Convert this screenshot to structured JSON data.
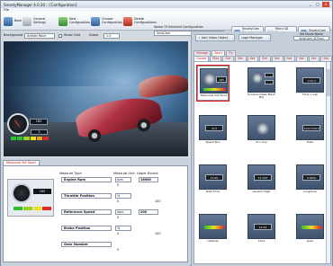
{
  "app": {
    "title": "SmartyManager 4.0.30 :: [Configuration]"
  },
  "menu": {
    "items": [
      "File"
    ]
  },
  "toolbar": {
    "back": "Back",
    "general_settings": "General Settings",
    "new_config": "New Configuration",
    "choose_config": "Choose Configuration",
    "delete_config": "Delete Configurations",
    "config_label": "Name Of Selected Configuration",
    "config_value": "SmkCam",
    "smartycam_firmware": "SmartyCam Firmware Transfer",
    "micro_sd": "Micro SD Firmware Transfer",
    "smartycam_id": "SmartyCam Identification"
  },
  "options": {
    "background_label": "Background",
    "background_value": "Artistic Race",
    "show_grid": "Show Grid",
    "zoom_label": "Zoom",
    "zoom_value": "1.0"
  },
  "video": {
    "speed_readout": "165",
    "gear_readout": "3"
  },
  "editor": {
    "tab": "Measures Set Sport",
    "headers": {
      "type": "Measure Type",
      "unit": "Measure Unit",
      "upper": "Upper Bound"
    },
    "rows": [
      {
        "name": "Engine Rpm",
        "unit": "rpm",
        "upper": "16000",
        "n1": "0",
        "n2": ""
      },
      {
        "name": "Throttle Position",
        "unit": "%",
        "upper": "",
        "n1": "0",
        "n2": "100"
      },
      {
        "name": "Reference Speed",
        "unit": "mph",
        "upper": "200",
        "n1": "0",
        "n2": ""
      },
      {
        "name": "Brake Position",
        "unit": "%",
        "upper": "",
        "n1": "0",
        "n2": "100"
      },
      {
        "name": "Gear Number",
        "unit": "",
        "upper": "",
        "n1": "0",
        "n2": ""
      }
    ],
    "preview_readout": "165"
  },
  "right": {
    "add_video": "Add Video Object",
    "logo_manager": "Logo Manager",
    "set_movie_label": "Set Movie Name",
    "set_movie_value": "SmkCam_SCP.avi",
    "tabs_main": [
      "Vintage",
      "Sport",
      "Fly"
    ],
    "tabs_sets": [
      "Copies",
      "Play",
      "Set 1",
      "Set 2",
      "Set 3",
      "Set 4",
      "Set 5",
      "Set 6",
      "Set 7",
      "Set 8",
      "Set 9"
    ],
    "tiles": [
      {
        "caption": "Measures Set Sport",
        "chip": "165",
        "kind": "gauge"
      },
      {
        "caption": "Accelerometer Black Big",
        "chip": "",
        "kind": "dot"
      },
      {
        "caption": "Time + Lap",
        "chip": "1:23.4",
        "kind": "chip"
      },
      {
        "caption": "Speed Box",
        "chip": "213",
        "kind": "chip"
      },
      {
        "caption": "Acc only",
        "chip": "",
        "kind": "disc"
      },
      {
        "caption": "Date",
        "chip": "12/07/2010",
        "kind": "chip"
      },
      {
        "caption": "Date Time",
        "chip": "15:20",
        "kind": "chip"
      },
      {
        "caption": "Generic Digit",
        "chip": "12.345",
        "kind": "chip"
      },
      {
        "caption": "Longitude",
        "chip": "0.0000",
        "kind": "chip"
      },
      {
        "caption": "Latitude",
        "chip": "",
        "kind": "bar"
      },
      {
        "caption": "Time",
        "chip": "12:34",
        "kind": "chip"
      },
      {
        "caption": "Gear",
        "chip": "",
        "kind": "bar"
      }
    ]
  },
  "colors": {
    "accent_red": "#e01414",
    "panel": "#c6ceda"
  }
}
